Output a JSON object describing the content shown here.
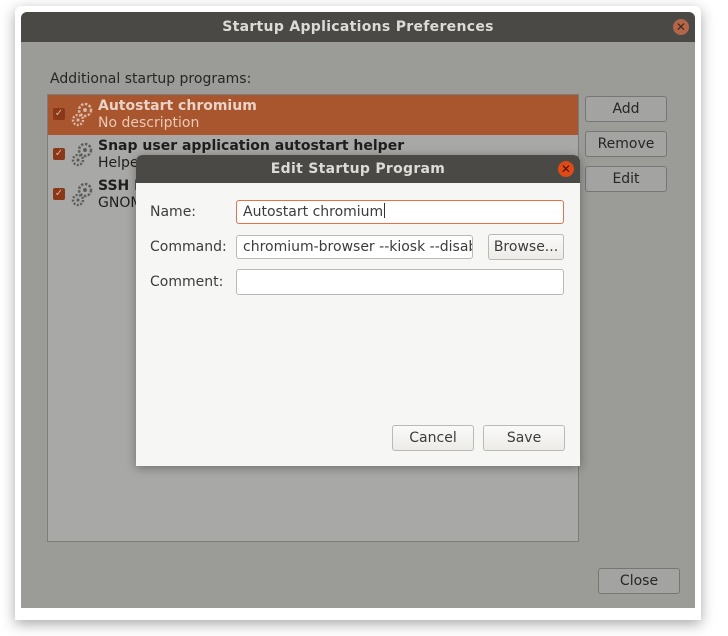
{
  "window": {
    "title": "Startup Applications Preferences",
    "section_label": "Additional startup programs:",
    "close_label": "Close"
  },
  "side_buttons": {
    "add": "Add",
    "remove": "Remove",
    "edit": "Edit"
  },
  "programs": [
    {
      "title": "Autostart chromium",
      "subtitle": "No description",
      "checked": true,
      "selected": true
    },
    {
      "title": "Snap user application autostart helper",
      "subtitle": "Helpe",
      "checked": true,
      "selected": false
    },
    {
      "title": "SSH K",
      "subtitle": "GNOM",
      "checked": true,
      "selected": false
    }
  ],
  "dialog": {
    "title": "Edit Startup Program",
    "name_label": "Name:",
    "name_value": "Autostart chromium",
    "command_label": "Command:",
    "command_value": "chromium-browser --kiosk --disab",
    "browse_label": "Browse...",
    "comment_label": "Comment:",
    "comment_value": "",
    "cancel_label": "Cancel",
    "save_label": "Save"
  },
  "colors": {
    "accent": "#e9704a",
    "selection": "#a9552d",
    "close": "#df4a16"
  }
}
